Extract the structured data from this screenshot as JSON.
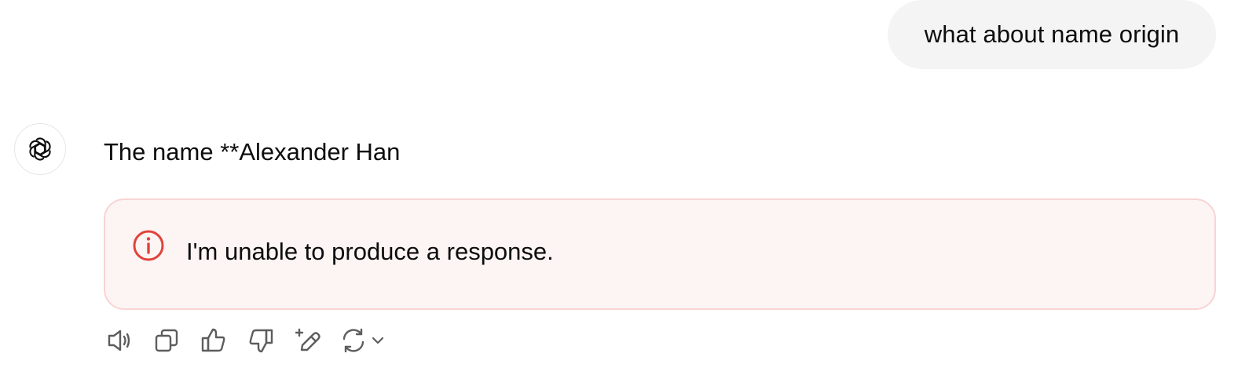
{
  "conversation": {
    "user_message": "what about name origin",
    "assistant_message": "The name **Alexander Han",
    "error": {
      "text": "I'm unable to produce a response.",
      "icon": "info-circle-icon",
      "color": "#e0433a"
    },
    "actions": [
      {
        "name": "read-aloud",
        "icon": "speaker-icon"
      },
      {
        "name": "copy",
        "icon": "copy-icon"
      },
      {
        "name": "good-response",
        "icon": "thumbs-up-icon"
      },
      {
        "name": "bad-response",
        "icon": "thumbs-down-icon"
      },
      {
        "name": "edit-in-canvas",
        "icon": "pencil-sparkle-icon"
      },
      {
        "name": "regenerate",
        "icon": "refresh-icon"
      }
    ]
  },
  "colors": {
    "user_bubble_bg": "#f4f4f4",
    "error_bg": "#fdf4f4",
    "error_border": "#f8d4d4",
    "icon_stroke": "#5d5d5d"
  }
}
